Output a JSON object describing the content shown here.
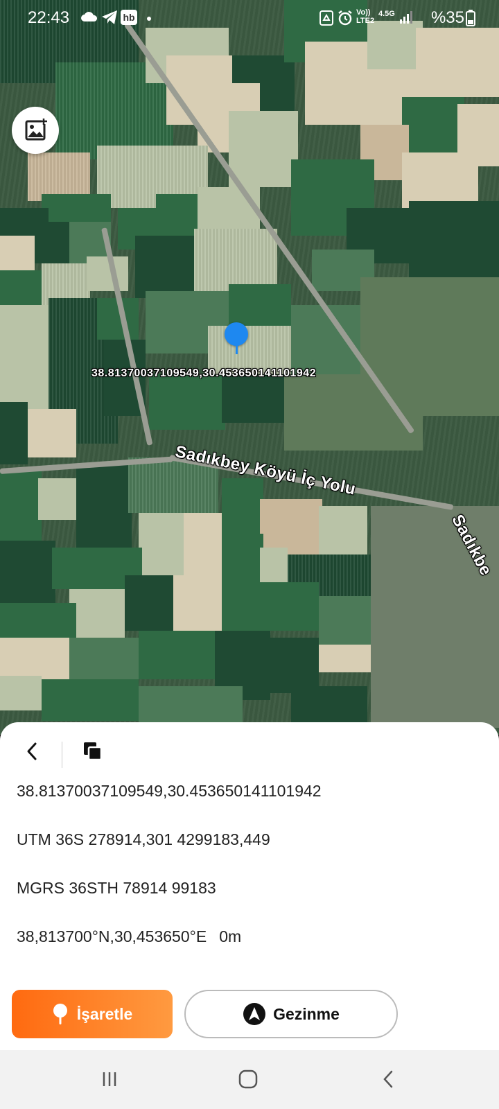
{
  "status_bar": {
    "time": "22:43",
    "left_icons": [
      "cloud-icon",
      "telegram-icon",
      "hb-app-icon",
      "dot-icon"
    ],
    "hb_label": "hb",
    "right_icons": [
      "recycle-icon",
      "alarm-icon",
      "volte-icon",
      "network-icon",
      "signal-icon",
      "battery-icon"
    ],
    "volte_label": "Vo)) LTE2",
    "network_label": "4.5G",
    "battery": "%35"
  },
  "map": {
    "coordinate_label": "38.81370037109549,30.453650141101942",
    "road_label_main": "Sadıkbey Köyü İç Yolu",
    "road_label_side": "Sadıkbe",
    "pin_color": "#1e88f0",
    "gallery_icon": "image-icon"
  },
  "sheet": {
    "back_icon": "chevron-left-icon",
    "copy_icon": "copy-icon",
    "decimal_coords": "38.81370037109549,30.453650141101942",
    "utm": "UTM 36S 278914,301 4299183,449",
    "mgrs": "MGRS 36STH 78914 99183",
    "dms": "38,813700°N,30,453650°E",
    "altitude": "0m",
    "mark_button": "İşaretle",
    "mark_icon": "pin-icon",
    "nav_button": "Gezinme",
    "nav_icon": "navigation-arrow-icon",
    "accent": "#ff7a20"
  },
  "navbar": {
    "recent_icon": "recent-apps-icon",
    "home_icon": "home-icon",
    "back_icon": "back-icon"
  }
}
